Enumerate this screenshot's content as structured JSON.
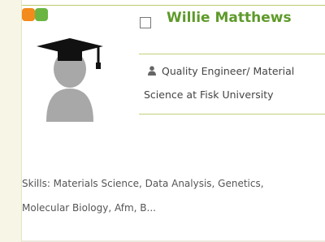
{
  "status_dots": {
    "colors": [
      "#f28a1c",
      "#6ab541"
    ]
  },
  "profile": {
    "name": "Willie Matthews",
    "title_line1": "Quality Engineer/ Material",
    "title_line2": "Science at Fisk University",
    "skills_line1": "Skills: Materials Science, Data Analysis, Genetics,",
    "skills_line2": "Molecular Biology, Afm, B..."
  },
  "icons": {
    "avatar": "graduate-avatar-icon",
    "person": "person-icon"
  },
  "colors": {
    "name": "#5e9a2a",
    "divider": "#c2d07a",
    "background": "#f7f6e6"
  }
}
